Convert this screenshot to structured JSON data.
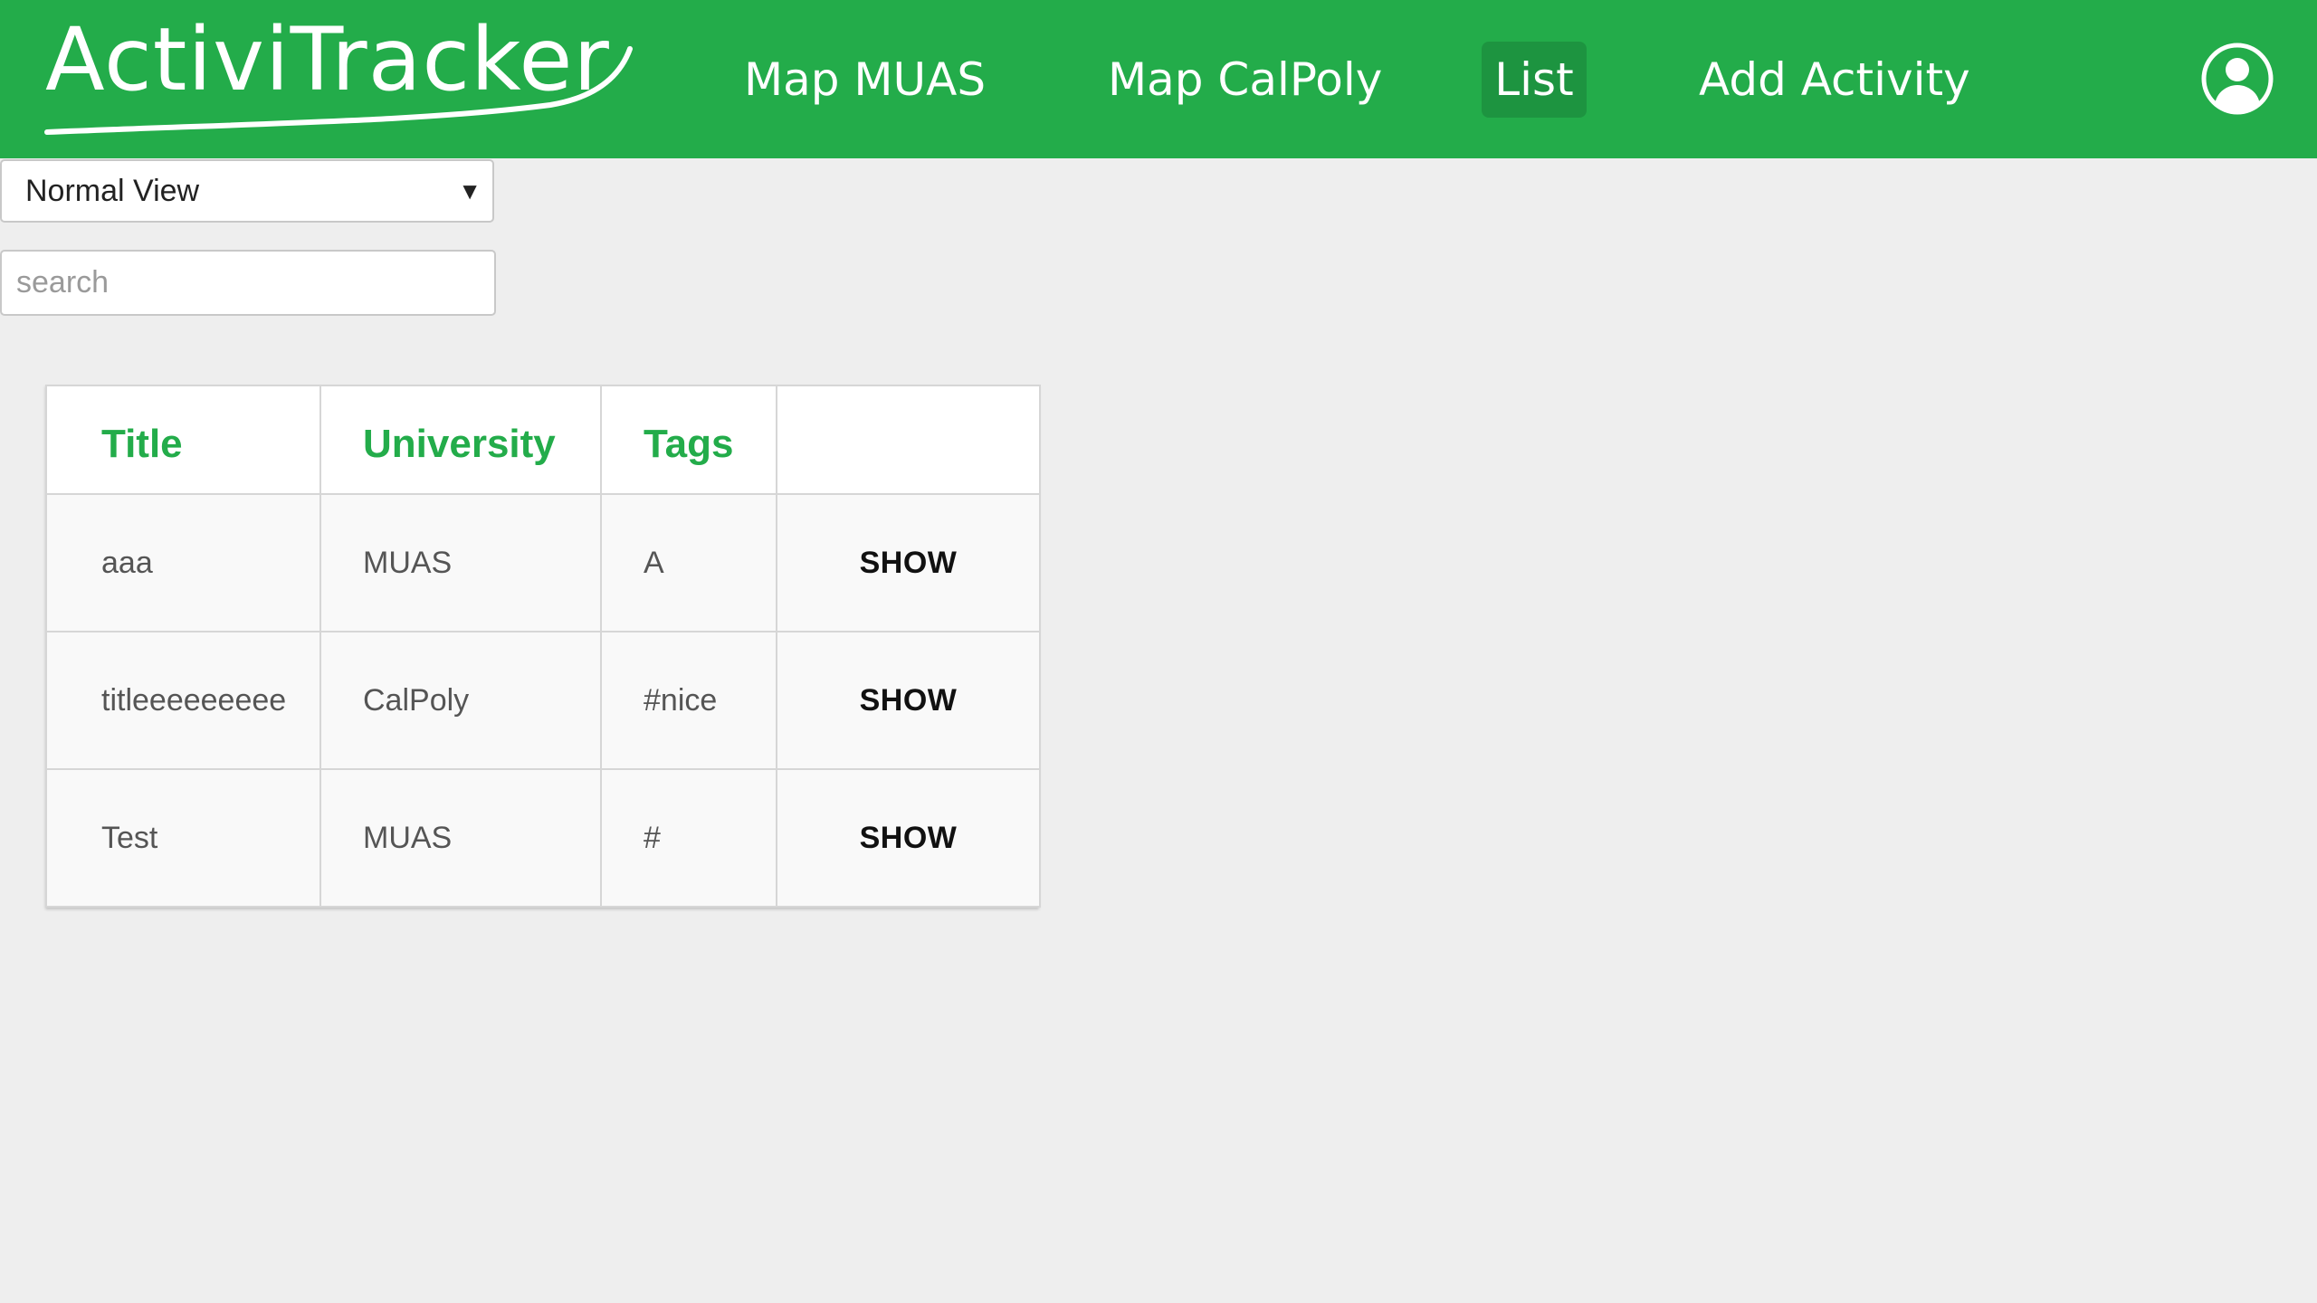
{
  "header": {
    "logo_text": "ActiviTracker",
    "nav": {
      "map_muas": "Map MUAS",
      "map_calpoly": "Map CalPoly",
      "list": "List",
      "add_activity": "Add Activity"
    },
    "active_nav": "List",
    "user_icon": "user-circle-icon"
  },
  "controls": {
    "view_select": {
      "selected": "Normal View"
    },
    "search": {
      "placeholder": "search",
      "value": ""
    }
  },
  "table": {
    "headers": {
      "title": "Title",
      "university": "University",
      "tags": "Tags",
      "action": ""
    },
    "rows": [
      {
        "title": "aaa",
        "university": "MUAS",
        "tags": "A",
        "action": "SHOW"
      },
      {
        "title": "titleeeeeeeee",
        "university": "CalPoly",
        "tags": "#nice",
        "action": "SHOW"
      },
      {
        "title": "Test",
        "university": "MUAS",
        "tags": "#",
        "action": "SHOW"
      }
    ]
  },
  "colors": {
    "brand_green": "#23ac4a",
    "active_nav_bg": "#1d9440",
    "page_bg": "#eeeeee"
  }
}
